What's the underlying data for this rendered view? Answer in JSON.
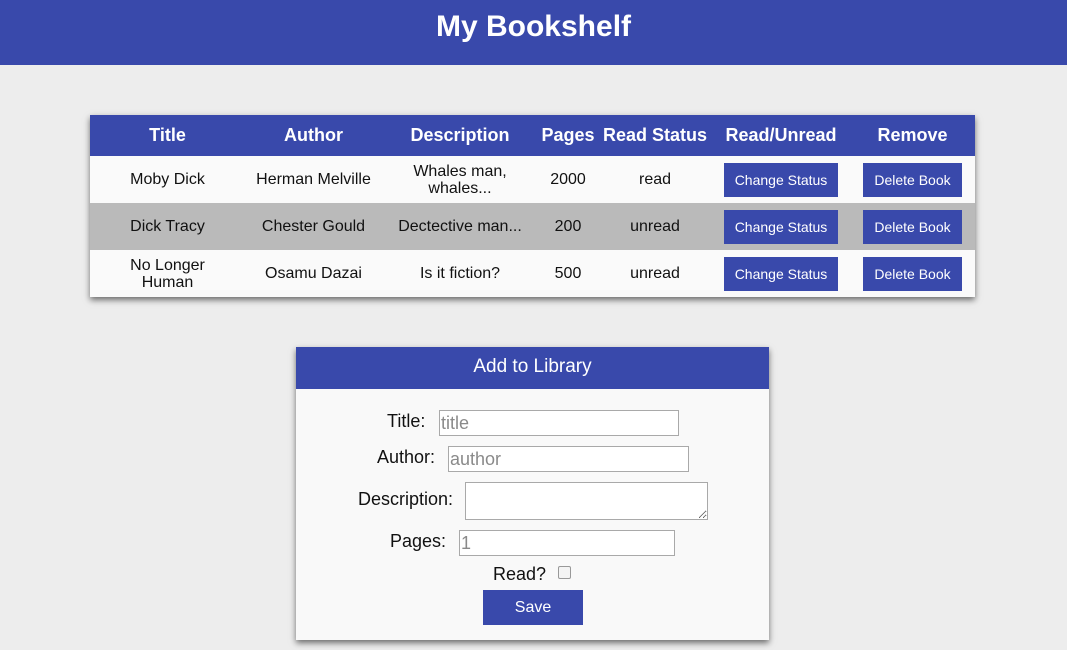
{
  "header": {
    "title": "My Bookshelf"
  },
  "colors": {
    "accent": "#3949ab",
    "alt_row": "#bababa"
  },
  "table": {
    "columns": [
      "Title",
      "Author",
      "Description",
      "Pages",
      "Read Status",
      "Read/Unread",
      "Remove"
    ],
    "rows": [
      {
        "title": "Moby Dick",
        "author": "Herman Melville",
        "description": "Whales man, whales...",
        "pages": "2000",
        "status": "read",
        "change_label": "Change Status",
        "delete_label": "Delete Book"
      },
      {
        "title": "Dick Tracy",
        "author": "Chester Gould",
        "description": "Dectective man...",
        "pages": "200",
        "status": "unread",
        "change_label": "Change Status",
        "delete_label": "Delete Book"
      },
      {
        "title": "No Longer Human",
        "author": "Osamu Dazai",
        "description": "Is it fiction?",
        "pages": "500",
        "status": "unread",
        "change_label": "Change Status",
        "delete_label": "Delete Book"
      }
    ]
  },
  "form": {
    "title": "Add to Library",
    "title_label": "Title:",
    "title_placeholder": "title",
    "author_label": "Author:",
    "author_placeholder": "author",
    "description_label": "Description:",
    "pages_label": "Pages:",
    "pages_placeholder": "1",
    "read_label": "Read?",
    "read_checked": false,
    "save_label": "Save"
  }
}
